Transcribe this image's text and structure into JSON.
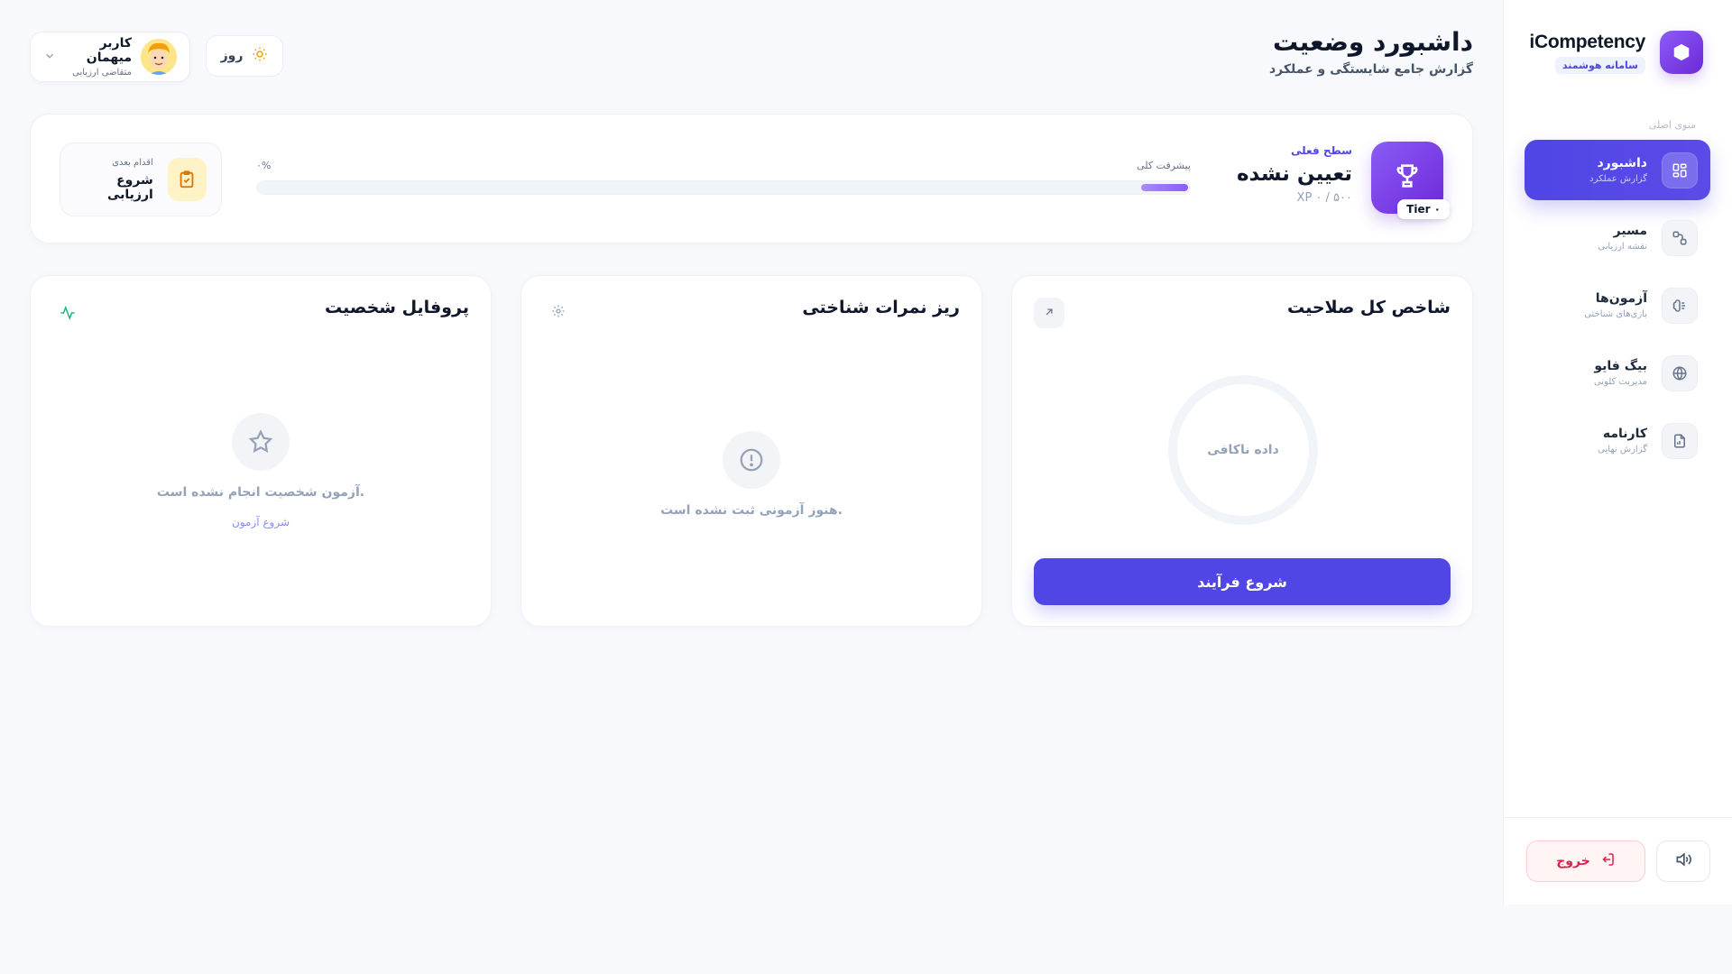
{
  "brand": {
    "name": "iCompetency",
    "tagline": "سامانه هوشمند"
  },
  "sidebar": {
    "caption": "منوی اصلی",
    "items": [
      {
        "label": "داشبورد",
        "sub": "گزارش عملکرد",
        "icon": "grid-icon",
        "active": true
      },
      {
        "label": "مسیر",
        "sub": "نقشه ارزیابی",
        "icon": "route-icon",
        "active": false
      },
      {
        "label": "آزمون‌ها",
        "sub": "بازی‌های شناختی",
        "icon": "brain-icon",
        "active": false
      },
      {
        "label": "بیگ فایو",
        "sub": "مدیریت کلونی",
        "icon": "globe-icon",
        "active": false
      },
      {
        "label": "کارنامه",
        "sub": "گزارش نهایی",
        "icon": "report-icon",
        "active": false
      }
    ],
    "logout_label": "خروج"
  },
  "header": {
    "title": "داشبورد وضعیت",
    "subtitle": "گزارش جامع شایستگی و عملکرد",
    "user_name": "کاربر میهمان",
    "user_role": "متقاضی ارزیابی",
    "theme_label": "روز"
  },
  "status": {
    "tier_badge": "Tier ۰",
    "level_caption": "سطح فعلی",
    "level_value": "تعیین نشده",
    "xp_text": "XP ۰ / ۵۰۰",
    "progress_label": "پیشرفت کلی",
    "progress_percent_text": "۰%",
    "progress_value": 0,
    "next_caption": "اقدام بعدی",
    "next_label": "شروع ارزیابی"
  },
  "cards": {
    "competency": {
      "title": "شاخص کل صلاحیت",
      "gauge_text": "داده ناکافی",
      "button": "شروع فرآیند"
    },
    "cognitive": {
      "title": "ریز نمرات شناختی",
      "empty_text": "هنوز آزمونی ثبت نشده است."
    },
    "personality": {
      "title": "پروفایل شخصیت",
      "empty_text": "آزمون شخصیت انجام نشده است.",
      "link": "شروع آزمون"
    }
  },
  "colors": {
    "primary": "#4f46e5",
    "accent_purple": "#8b5cf6",
    "danger": "#e11d48",
    "amber": "#d97706",
    "green": "#10b981"
  }
}
